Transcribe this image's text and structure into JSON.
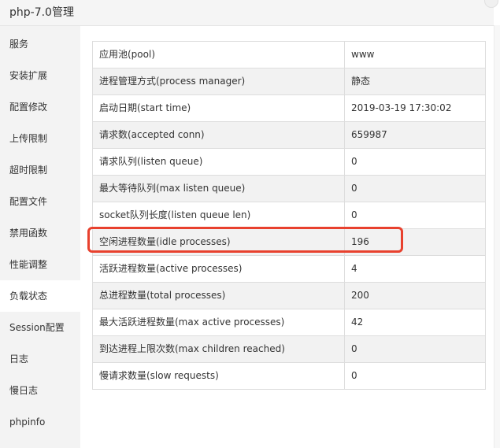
{
  "window": {
    "title": "php-7.0管理"
  },
  "sidebar": {
    "active_index": 8,
    "items": [
      {
        "label": "服务"
      },
      {
        "label": "安装扩展"
      },
      {
        "label": "配置修改"
      },
      {
        "label": "上传限制"
      },
      {
        "label": "超时限制"
      },
      {
        "label": "配置文件"
      },
      {
        "label": "禁用函数"
      },
      {
        "label": "性能调整"
      },
      {
        "label": "负载状态"
      },
      {
        "label": "Session配置"
      },
      {
        "label": "日志"
      },
      {
        "label": "慢日志"
      },
      {
        "label": "phpinfo"
      }
    ]
  },
  "status_table": {
    "highlighted_row_index": 7,
    "highlight_color": "#e8412e",
    "rows": [
      {
        "label": "应用池(pool)",
        "value": "www"
      },
      {
        "label": "进程管理方式(process manager)",
        "value": "静态"
      },
      {
        "label": "启动日期(start time)",
        "value": "2019-03-19 17:30:02"
      },
      {
        "label": "请求数(accepted conn)",
        "value": "659987"
      },
      {
        "label": "请求队列(listen queue)",
        "value": "0"
      },
      {
        "label": "最大等待队列(max listen queue)",
        "value": "0"
      },
      {
        "label": "socket队列长度(listen queue len)",
        "value": "0"
      },
      {
        "label": "空闲进程数量(idle processes)",
        "value": "196"
      },
      {
        "label": "活跃进程数量(active processes)",
        "value": "4"
      },
      {
        "label": "总进程数量(total processes)",
        "value": "200"
      },
      {
        "label": "最大活跃进程数量(max active processes)",
        "value": "42"
      },
      {
        "label": "到达进程上限次数(max children reached)",
        "value": "0"
      },
      {
        "label": "慢请求数量(slow requests)",
        "value": "0"
      }
    ]
  }
}
